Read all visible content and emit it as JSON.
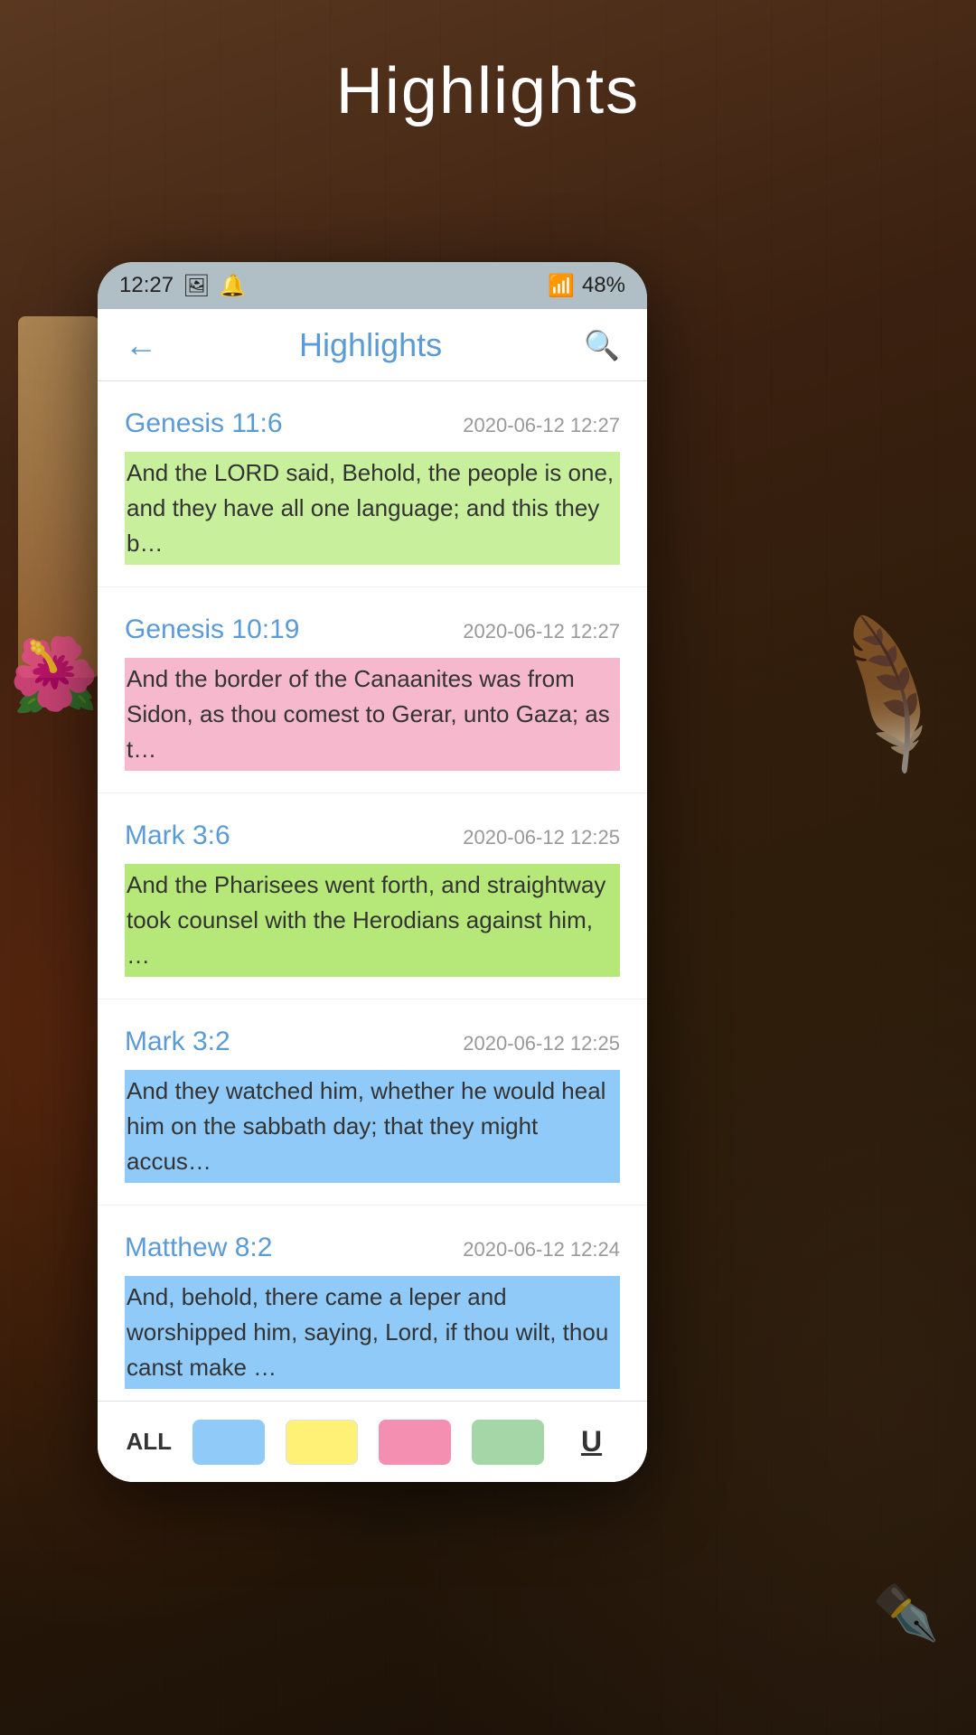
{
  "page": {
    "title": "Highlights",
    "background_description": "wooden table with scripture scrolls and feathers"
  },
  "status_bar": {
    "time": "12:27",
    "battery": "48%",
    "signal_icon": "signal-icon",
    "battery_icon": "battery-icon"
  },
  "app_header": {
    "title": "Highlights",
    "back_label": "←",
    "search_label": "🔍"
  },
  "highlights": [
    {
      "ref": "Genesis 11:6",
      "date": "2020-06-12 12:27",
      "text": "And the LORD said, Behold, the people is one, and they have all one language; and this they b…",
      "highlight_color": "green",
      "highlight_hex": "#c8f09c"
    },
    {
      "ref": "Genesis 10:19",
      "date": "2020-06-12 12:27",
      "text": "And the border of the Canaanites was from Sidon, as thou comest to Gerar, unto Gaza; as t…",
      "highlight_color": "pink",
      "highlight_hex": "#f5b8cc"
    },
    {
      "ref": "Mark 3:6",
      "date": "2020-06-12 12:25",
      "text": "And the Pharisees went forth, and straightway took counsel with the Herodians against him, …",
      "highlight_color": "green2",
      "highlight_hex": "#b5e878"
    },
    {
      "ref": "Mark 3:2",
      "date": "2020-06-12 12:25",
      "text": "And they watched him, whether he would heal him on the sabbath day; that they might accus…",
      "highlight_color": "blue",
      "highlight_hex": "#90caf9"
    },
    {
      "ref": "Matthew 8:2",
      "date": "2020-06-12 12:24",
      "text": "And, behold, there came a leper and worshipped him, saying, Lord, if thou wilt, thou canst make …",
      "highlight_color": "blue2",
      "highlight_hex": "#90caf9"
    }
  ],
  "bottom_bar": {
    "all_label": "ALL",
    "colors": [
      {
        "name": "blue-chip",
        "hex": "#90caf9"
      },
      {
        "name": "yellow-chip",
        "hex": "#fff176"
      },
      {
        "name": "pink-chip",
        "hex": "#f48fb1"
      },
      {
        "name": "green-chip",
        "hex": "#a5d6a7"
      }
    ],
    "underline_label": "U"
  }
}
